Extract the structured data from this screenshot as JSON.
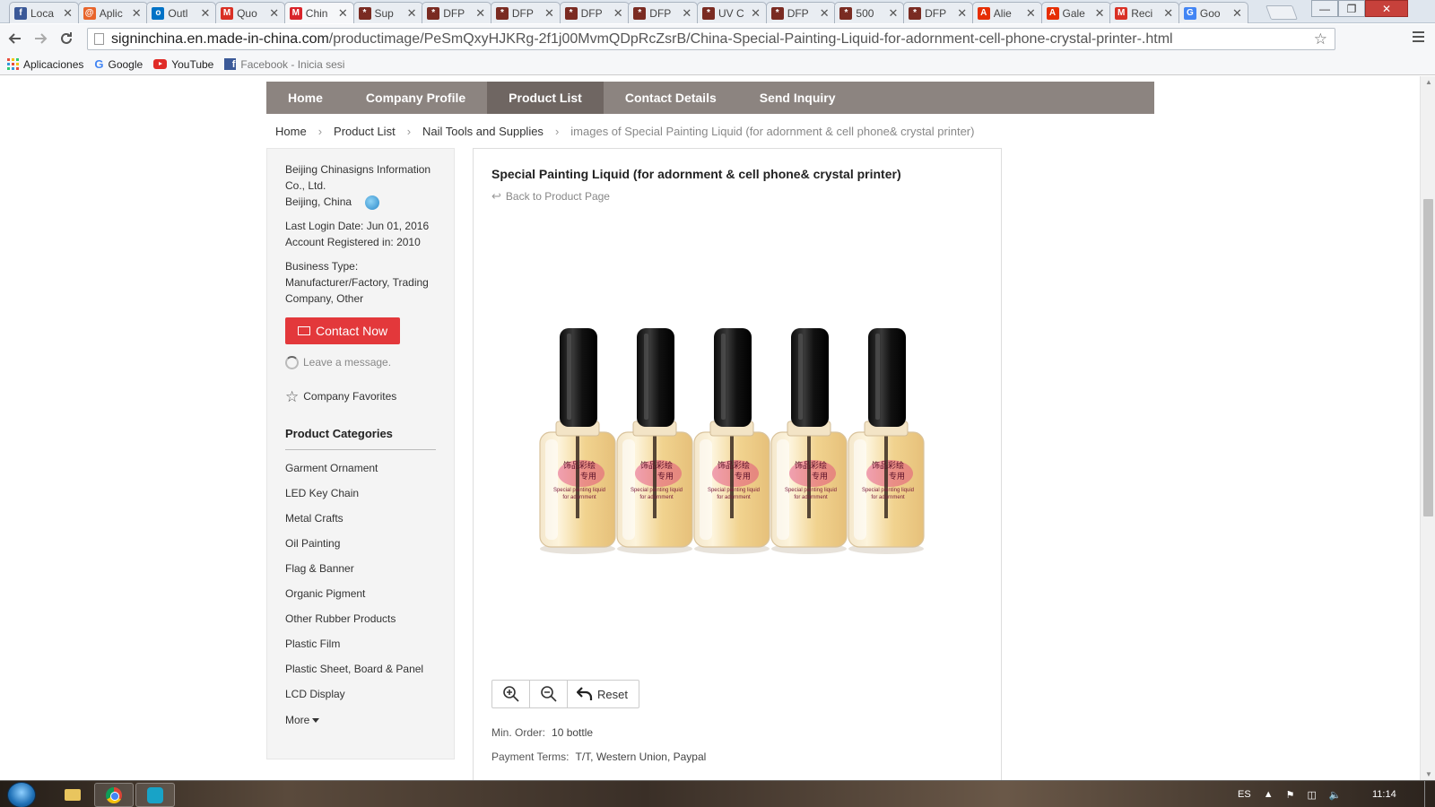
{
  "browser": {
    "tabs": [
      {
        "title": "Loca",
        "favicon": "facebook-icon",
        "color": "#3b5998",
        "glyph": "f"
      },
      {
        "title": "Aplic",
        "favicon": "orange-circle-icon",
        "color": "#e8642b",
        "glyph": "@"
      },
      {
        "title": "Outl",
        "favicon": "outlook-icon",
        "color": "#0072c6",
        "glyph": "o"
      },
      {
        "title": "Quo",
        "favicon": "gmail-icon",
        "color": "#d93025",
        "glyph": "M"
      },
      {
        "title": "Chin",
        "favicon": "made-in-china-icon",
        "color": "#d9232a",
        "glyph": "M",
        "active": true
      },
      {
        "title": "Sup",
        "favicon": "site-icon",
        "color": "#7a2b22",
        "glyph": "*"
      },
      {
        "title": "DFP",
        "favicon": "site-icon",
        "color": "#7a2b22",
        "glyph": "*"
      },
      {
        "title": "DFP",
        "favicon": "site-icon",
        "color": "#7a2b22",
        "glyph": "*"
      },
      {
        "title": "DFP",
        "favicon": "site-icon",
        "color": "#7a2b22",
        "glyph": "*"
      },
      {
        "title": "DFP",
        "favicon": "site-icon",
        "color": "#7a2b22",
        "glyph": "*"
      },
      {
        "title": "UV C",
        "favicon": "site-icon",
        "color": "#7a2b22",
        "glyph": "*"
      },
      {
        "title": "DFP",
        "favicon": "site-icon",
        "color": "#7a2b22",
        "glyph": "*"
      },
      {
        "title": "500",
        "favicon": "site-icon",
        "color": "#7a2b22",
        "glyph": "*"
      },
      {
        "title": "DFP",
        "favicon": "site-icon",
        "color": "#7a2b22",
        "glyph": "*"
      },
      {
        "title": "Alie",
        "favicon": "aliexpress-icon",
        "color": "#e62e04",
        "glyph": "A"
      },
      {
        "title": "Gale",
        "favicon": "aliexpress-icon",
        "color": "#e62e04",
        "glyph": "A"
      },
      {
        "title": "Reci",
        "favicon": "gmail-icon",
        "color": "#d93025",
        "glyph": "M"
      },
      {
        "title": "Goo",
        "favicon": "google-translate-icon",
        "color": "#4285f4",
        "glyph": "G"
      }
    ],
    "url_host": "signinchina.en.made-in-china.com",
    "url_path": "/productimage/PeSmQxyHJKRg-2f1j00MvmQDpRcZsrB/China-Special-Painting-Liquid-for-adornment-cell-phone-crystal-printer-.html",
    "bookmarks": {
      "apps": "Aplicaciones",
      "google": "Google",
      "youtube": "YouTube",
      "facebook": "Facebook - Inicia sesi"
    }
  },
  "site": {
    "nav": [
      "Home",
      "Company Profile",
      "Product List",
      "Contact Details",
      "Send Inquiry"
    ],
    "nav_active": "Product List",
    "breadcrumb": [
      "Home",
      "Product List",
      "Nail Tools and Supplies",
      "images of Special Painting Liquid (for adornment & cell phone& crystal printer)"
    ]
  },
  "sidebar": {
    "company_name": "Beijing Chinasigns Information Co., Ltd.",
    "location": "Beijing, China",
    "last_login": "Last Login Date: Jun 01, 2016",
    "registered": "Account Registered in: 2010",
    "business_type_label": "Business Type:",
    "business_type": "Manufacturer/Factory, Trading Company, Other",
    "contact_label": "Contact Now",
    "leave_message": "Leave a message.",
    "favorites": "Company Favorites",
    "categories_title": "Product Categories",
    "categories": [
      "Garment Ornament",
      "LED Key Chain",
      "Metal Crafts",
      "Oil Painting",
      "Flag & Banner",
      "Organic Pigment",
      "Other Rubber Products",
      "Plastic Film",
      "Plastic Sheet, Board & Panel",
      "LCD Display"
    ],
    "more": "More"
  },
  "product": {
    "title": "Special Painting Liquid (for adornment & cell phone& crystal printer)",
    "back_link": "Back to Product Page",
    "image_label_cn": "饰品彩绘",
    "image_label_cn2": "专用",
    "image_label_en": "Special painting liquid",
    "image_label_en2": "for adornment",
    "bottle_count": 5,
    "reset_label": "Reset",
    "min_order_label": "Min. Order:",
    "min_order_value": "10 bottle",
    "payment_label": "Payment Terms:",
    "payment_value": "T/T, Western Union, Paypal"
  },
  "taskbar": {
    "language": "ES",
    "time": "11:14"
  }
}
